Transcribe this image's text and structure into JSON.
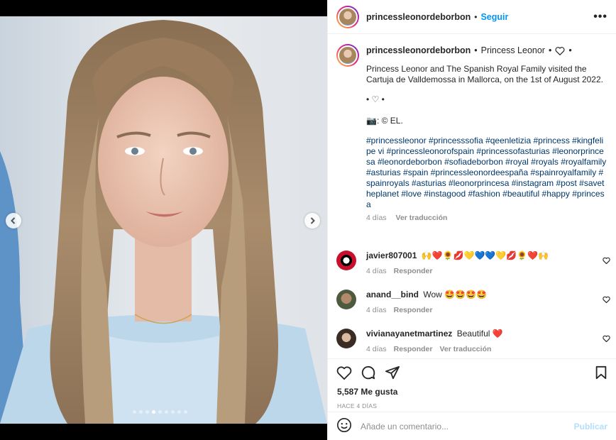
{
  "post": {
    "username": "princessleonordeborbon",
    "follow_label": "Seguir",
    "caption_title": "Princess Leonor",
    "caption_text": "Princess Leonor and The Spanish Royal Family visited the Cartuja de Valldemossa in Mallorca, on the 1st of August 2022.",
    "caption_bullet": "• ♡ •",
    "caption_credit": "📷: © EL.",
    "hashtags": "#princessleonor #princesssofia #qeenletizia #princess #kingfelipe vi #princessleonorofspain #princessofasturias #leonorprincesa #leonordeborbon #sofiadeborbon #royal #royals #royalfamily #asturias #spain #princessleonordeespaña #spainroyalfamily #spainroyals #asturias #leonorprincesa #instagram #post #savetheplanet #love #instagood #fashion #beautiful #happy #princesa",
    "caption_time": "4 días",
    "see_translation": "Ver traducción"
  },
  "comments": [
    {
      "user": "javier807001",
      "text": "🙌❤️🌻💋💛💙💙💛💋🌻❤️🙌",
      "time": "4 días",
      "reply": "Responder"
    },
    {
      "user": "anand__bind",
      "text": "Wow 🤩🤩🤩🤩",
      "time": "4 días",
      "reply": "Responder"
    },
    {
      "user": "vivianayanetmartinez",
      "text": "Beautiful ❤️",
      "time": "4 días",
      "reply": "Responder",
      "translate": "Ver traducción"
    }
  ],
  "engagement": {
    "likes": "5,587 Me gusta",
    "posted_ago": "HACE 4 DÍAS"
  },
  "composer": {
    "placeholder": "Añade un comentario...",
    "publish_label": "Publicar"
  },
  "carousel": {
    "slide_count": 9,
    "active_index": 3
  },
  "colors": {
    "accent": "#0095f6",
    "hashtag": "#00376b",
    "muted": "#8e8e8e",
    "publish_disabled": "#b2dffc"
  }
}
